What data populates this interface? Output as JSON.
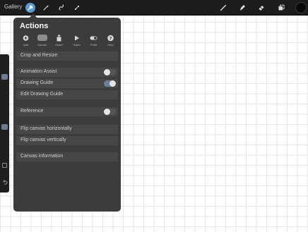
{
  "topbar": {
    "gallery_label": "Gallery",
    "left_tools": [
      "wrench-icon",
      "magic-wand-icon",
      "selection-icon",
      "transform-icon"
    ],
    "right_tools": [
      "brush-icon",
      "smudge-icon",
      "eraser-icon",
      "layers-icon"
    ],
    "color_swatch": "#0a0a0a"
  },
  "panel": {
    "title": "Actions",
    "tabs": [
      {
        "label": "Add",
        "icon": "add-icon"
      },
      {
        "label": "Canvas",
        "icon": "canvas-icon",
        "active": true
      },
      {
        "label": "Share",
        "icon": "share-icon"
      },
      {
        "label": "Video",
        "icon": "video-icon"
      },
      {
        "label": "Prefs",
        "icon": "prefs-icon"
      },
      {
        "label": "Help",
        "icon": "help-icon"
      }
    ],
    "items": {
      "crop_resize": "Crop and Resize",
      "animation_assist": "Animation Assist",
      "drawing_guide": "Drawing Guide",
      "edit_drawing_guide": "Edit Drawing Guide",
      "reference": "Reference",
      "flip_horizontal": "Flip canvas horizontally",
      "flip_vertical": "Flip canvas vertically",
      "canvas_information": "Canvas information"
    },
    "toggles": {
      "animation_assist": false,
      "drawing_guide": true,
      "reference": false
    }
  },
  "colors": {
    "accent": "#5b9bd5",
    "panel_bg": "#3c3c3c",
    "toggle_on": "#6d7f98"
  }
}
